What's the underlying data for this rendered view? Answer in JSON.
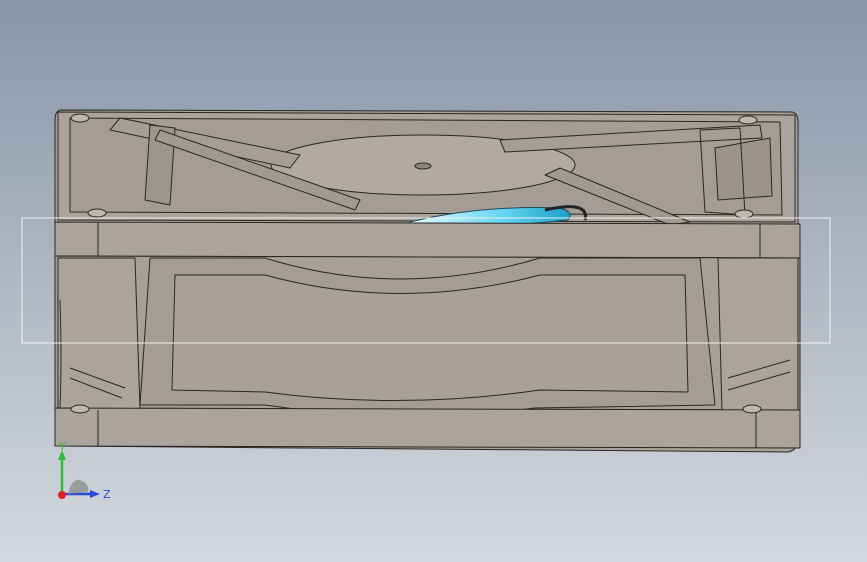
{
  "viewport": {
    "background_top": "#8a98aa",
    "background_bottom": "#d3d7dd",
    "model_color": "#a8a29a",
    "edge_color": "#2a2622",
    "highlight_color": "#58c8e8",
    "selection_box_color": "#f2f2f2"
  },
  "triad": {
    "y_label": "Y",
    "z_label": "Z",
    "y_color": "#2ebf3a",
    "z_color": "#2a4bdc",
    "x_color": "#e02020"
  }
}
